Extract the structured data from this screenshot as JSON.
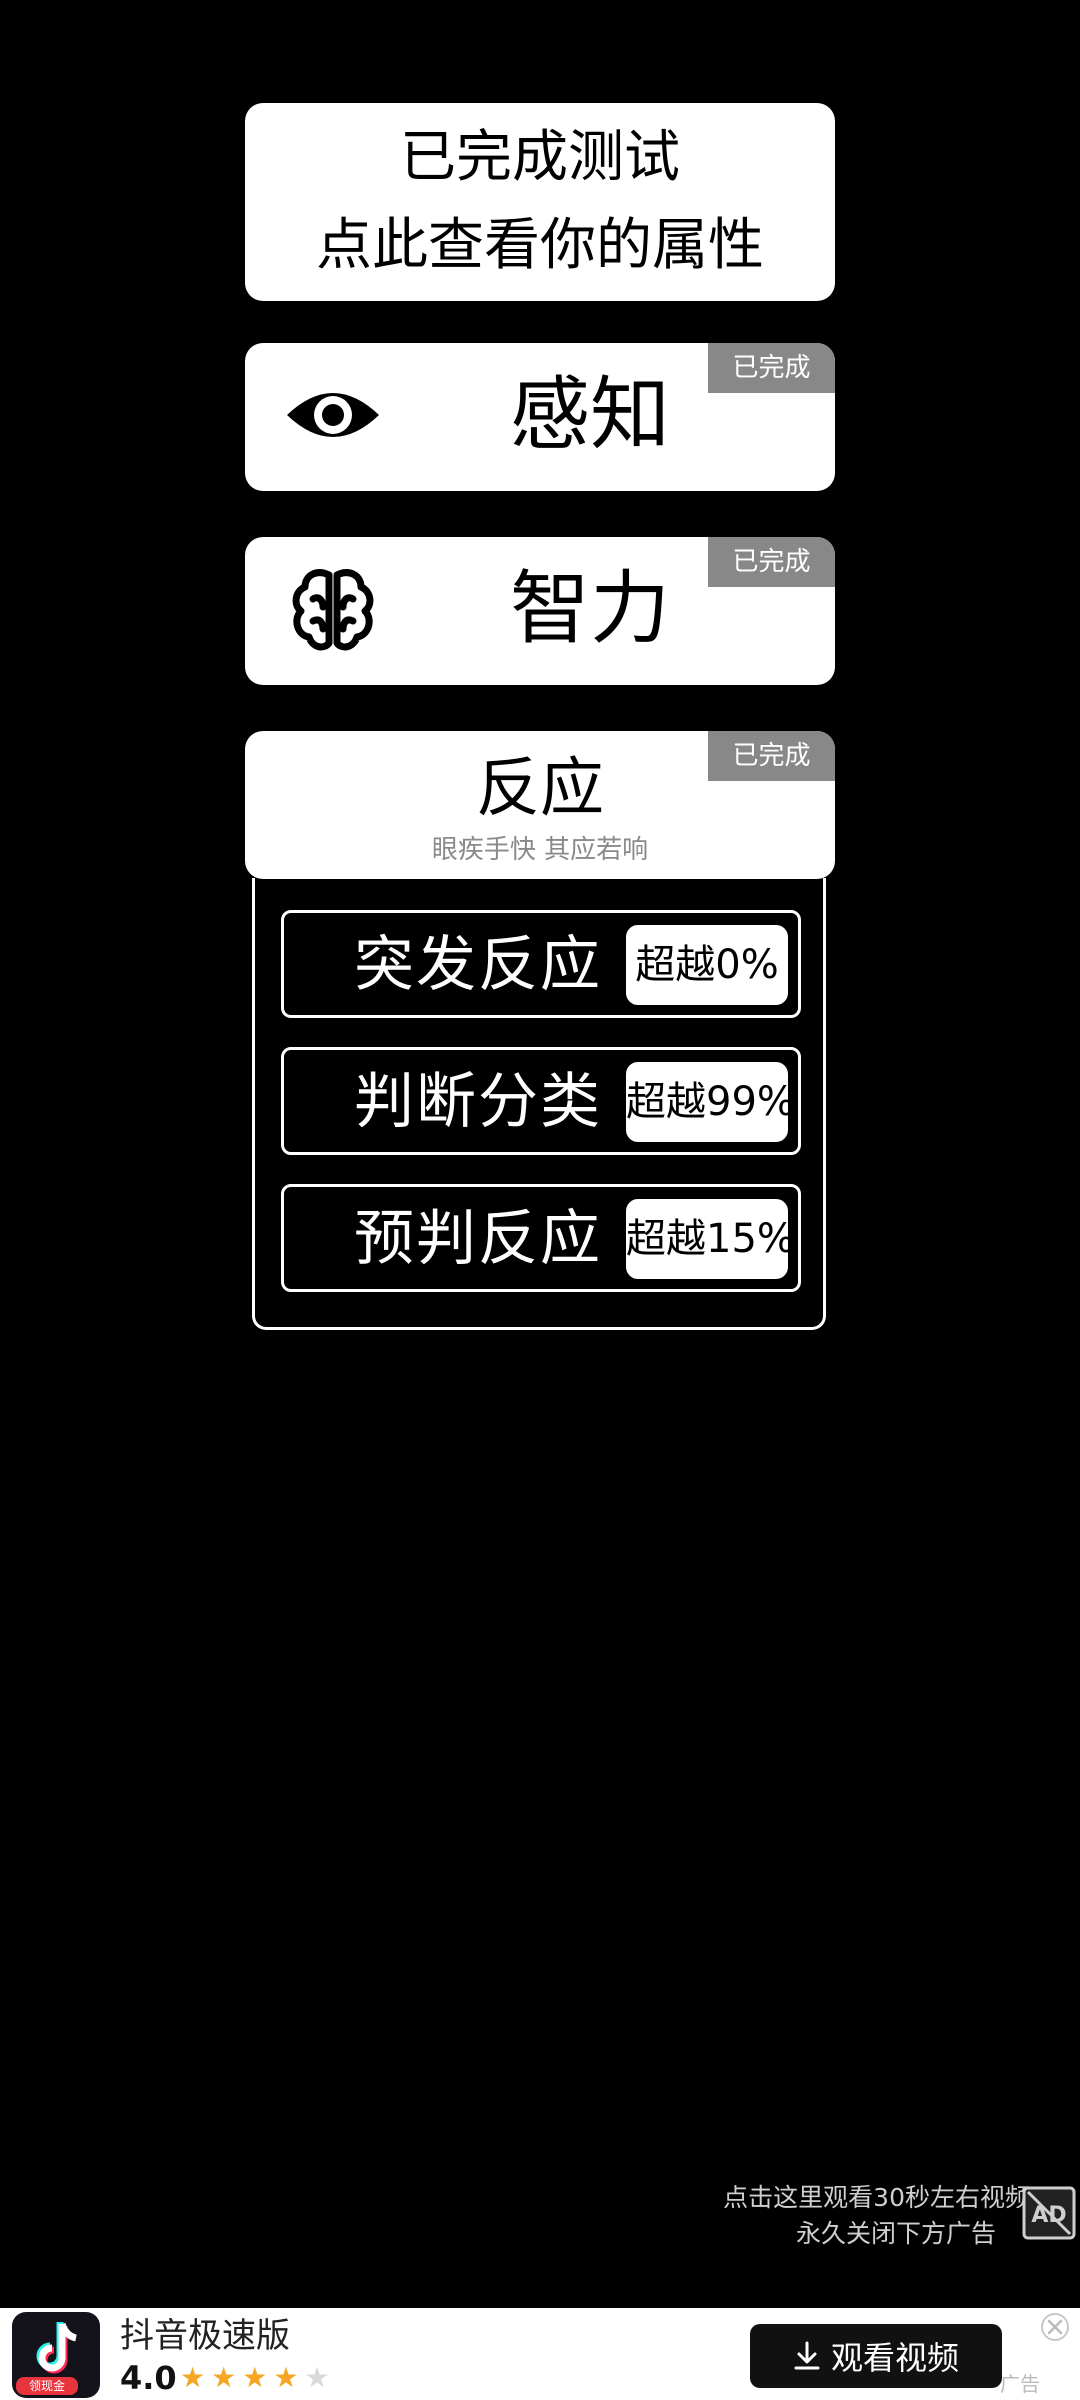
{
  "summary": {
    "line1": "已完成测试",
    "line2": "点此查看你的属性"
  },
  "categories": [
    {
      "title": "感知",
      "badge": "已完成",
      "icon": "eye-icon"
    },
    {
      "title": "智力",
      "badge": "已完成",
      "icon": "brain-icon"
    },
    {
      "title": "反应",
      "subtitle": "眼疾手快 其应若响",
      "badge": "已完成"
    }
  ],
  "reaction_tests": [
    {
      "label": "突发反应",
      "score": "超越0%"
    },
    {
      "label": "判断分类",
      "score": "超越99%"
    },
    {
      "label": "预判反应",
      "score": "超越15%"
    }
  ],
  "ad_remove": {
    "line1": "点击这里观看30秒左右视频",
    "line2": "永久关闭下方广告",
    "icon": "no-ad-icon"
  },
  "ad": {
    "app_name": "抖音极速版",
    "rating": "4.0",
    "rating_value": 4,
    "rating_max": 5,
    "icon_tag": "领现金",
    "button_label": "观看视频",
    "label": "广告",
    "accent": "#f5a623"
  }
}
